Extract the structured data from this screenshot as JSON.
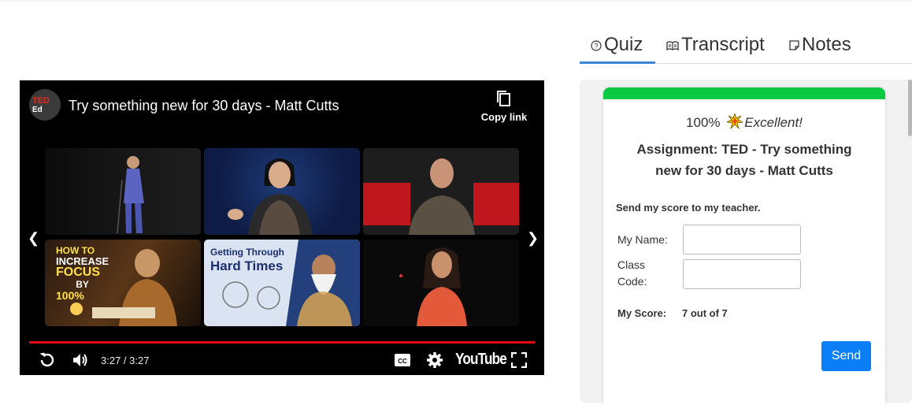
{
  "player": {
    "channel_logo": {
      "line1": "TED",
      "line2": "Ed"
    },
    "title": "Try something new for 30 days - Matt Cutts",
    "copy_link_label": "Copy link",
    "time": "3:27 / 3:27",
    "brand": "YouTube",
    "progress_fraction": 1.0,
    "accent_color": "#e50914",
    "recommendations": [
      {
        "text": ""
      },
      {
        "text": ""
      },
      {
        "text": ""
      },
      {
        "text_lines": [
          "HOW TO",
          "INCREASE",
          "FOCUS",
          "BY",
          "100%"
        ]
      },
      {
        "text_lines": [
          "Getting Through",
          "Hard Times"
        ]
      },
      {
        "text": ""
      }
    ]
  },
  "tabs": [
    {
      "label": "Quiz",
      "icon": "question-circle-icon",
      "active": true
    },
    {
      "label": "Transcript",
      "icon": "book-icon",
      "active": false
    },
    {
      "label": "Notes",
      "icon": "note-icon",
      "active": false
    }
  ],
  "quiz": {
    "percent": "100%",
    "verdict": "Excellent!",
    "status_color": "#0bc943",
    "assignment_title": "Assignment: TED - Try something new for 30 days - Matt Cutts",
    "send_score_label": "Send my score to my teacher.",
    "name_label": "My Name:",
    "class_code_label": "Class Code:",
    "name_value": "",
    "class_code_value": "",
    "my_score_label": "My Score:",
    "my_score_value": "7 out of 7",
    "send_button": "Send"
  }
}
